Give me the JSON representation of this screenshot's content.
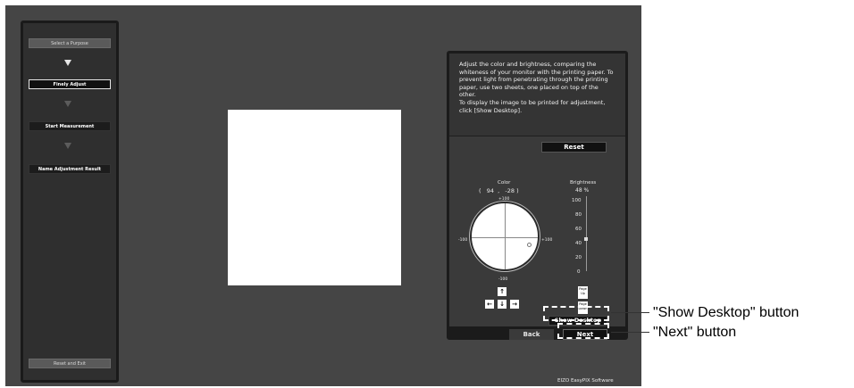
{
  "steps": {
    "select_purpose": "Select a Purpose",
    "finely_adjust": "Finely Adjust",
    "start_measurement": "Start Measurement",
    "name_result": "Name Adjustment Result",
    "reset_exit": "Reset and Exit"
  },
  "panel": {
    "instructions": "Adjust the color and brightness, comparing the whiteness of your monitor with the printing paper. To prevent light from penetrating through the printing paper, use two sheets, one placed on top of the other.\nTo display the image to be printed for adjustment, click [Show Desktop].",
    "reset_label": "Reset",
    "color_label": "Color",
    "color_value": "(   94  ,   -28 )",
    "color_top": "+100",
    "color_bottom": "-100",
    "color_left": "-100",
    "color_right": "+100",
    "brightness_label": "Brightness",
    "brightness_value": "48 %",
    "brightness_ticks": [
      "100",
      "80",
      "60",
      "40",
      "20",
      "0"
    ],
    "page_up": "Page\nUp",
    "page_down": "Page\nDown",
    "show_desktop_label": "Show Desktop",
    "back_label": "Back",
    "next_label": "Next"
  },
  "footer": "EIZO EasyPIX Software",
  "callouts": {
    "show_desktop": "\"Show Desktop\" button",
    "next": "\"Next\" button"
  },
  "colors": {
    "background": "#454545",
    "panel": "#3a3a3a",
    "accent": "#ffffff"
  }
}
